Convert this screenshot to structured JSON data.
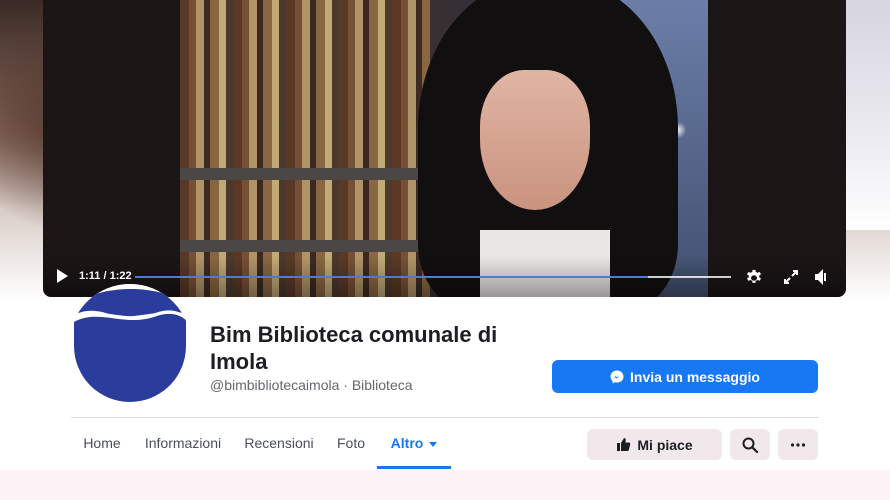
{
  "video": {
    "time": "1:11 / 1:22",
    "progress": 0.86,
    "icons": [
      "play-icon",
      "settings-icon",
      "fullscreen-icon",
      "volume-icon"
    ]
  },
  "page": {
    "name": "Bim Biblioteca comunale di Imola",
    "handle": "@bimbibliotecaimola · Biblioteca"
  },
  "actions": {
    "message_label": "Invia un messaggio",
    "like_label": "Mi piace"
  },
  "tabs": [
    {
      "label": "Home"
    },
    {
      "label": "Informazioni"
    },
    {
      "label": "Recensioni"
    },
    {
      "label": "Foto"
    },
    {
      "label": "Altro"
    }
  ],
  "colors": {
    "accent": "#1877f2",
    "logo_blue": "#2a3d9c",
    "secondary_button": "#f1e8ec"
  }
}
